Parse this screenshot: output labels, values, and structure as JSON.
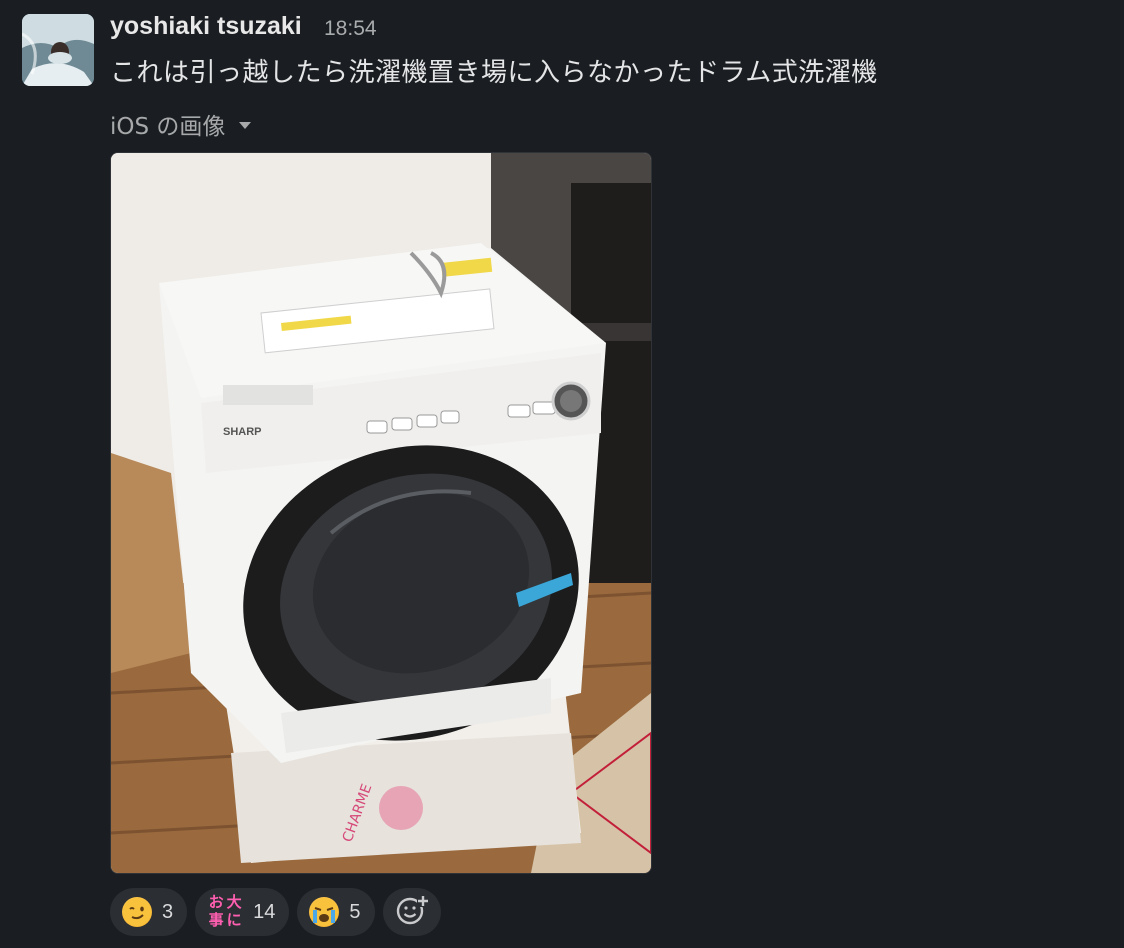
{
  "message": {
    "author": "yoshiaki tsuzaki",
    "time": "18:54",
    "text": "これは引っ越したら洗濯機置き場に入らなかったドラム式洗濯機",
    "attachment_label": "iOS の画像"
  },
  "photo": {
    "brand": "SHARP"
  },
  "reactions": [
    {
      "emoji": "wink-face-icon",
      "count": "3"
    },
    {
      "emoji": "odaijini-icon",
      "glyphs": [
        "お",
        "大",
        "事",
        "に"
      ],
      "count": "14"
    },
    {
      "emoji": "loudly-crying-face-icon",
      "count": "5"
    }
  ],
  "colors": {
    "background": "#1a1d21",
    "reaction_pill": "#2b2e33",
    "text_primary": "#e4e5e6",
    "text_secondary": "#a6a8aa"
  }
}
